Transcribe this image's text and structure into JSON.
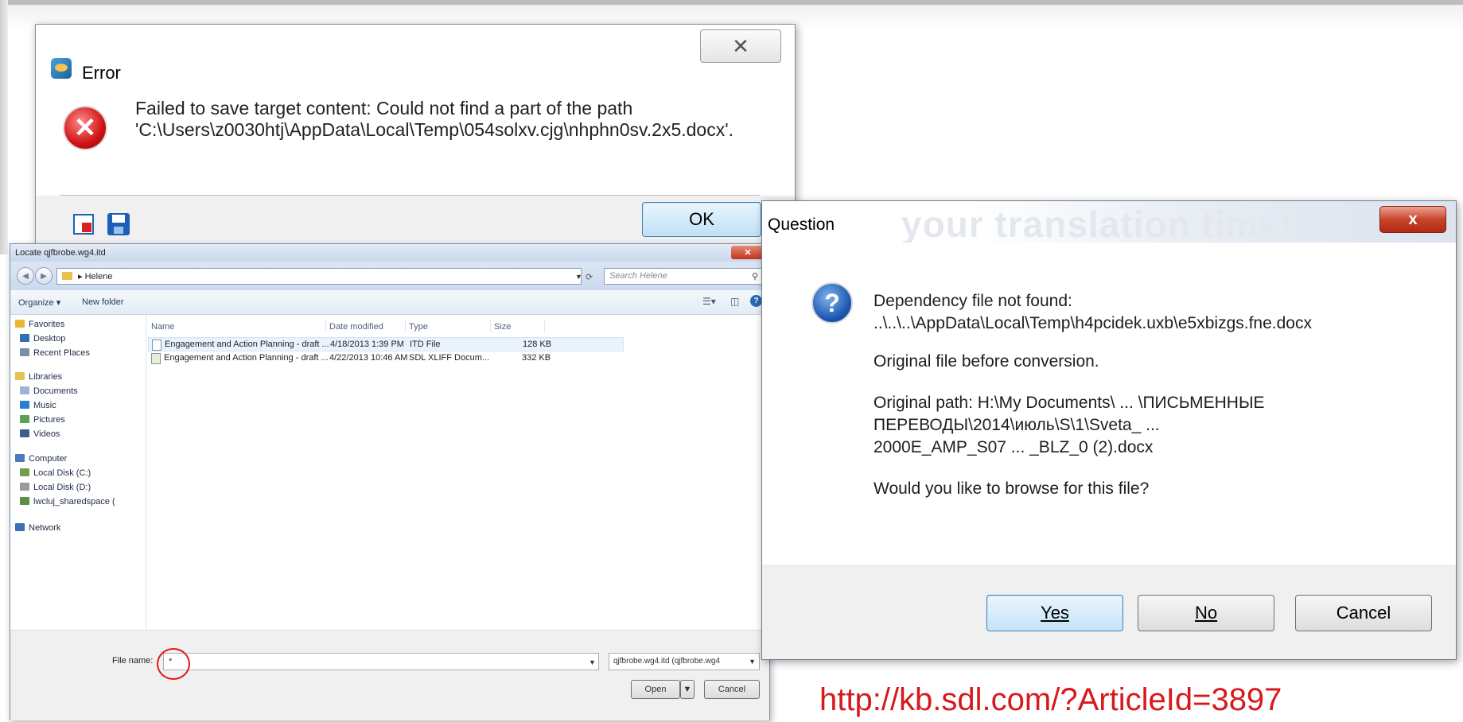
{
  "error_dialog": {
    "title": "Error",
    "message_line1": "Failed to save target content: Could not find a part of the path",
    "message_line2": "'C:\\Users\\z0030htj\\AppData\\Local\\Temp\\054solxv.cjg\\nhphn0sv.2x5.docx'.",
    "close_glyph": "✕",
    "ok_label": "OK"
  },
  "file_dialog": {
    "title": "Locate qjfbrobe.wg4.itd",
    "address": "▸ Helene",
    "search_placeholder": "Search Helene",
    "toolbar": {
      "organize": "Organize ▾",
      "new_folder": "New folder"
    },
    "sidebar": [
      {
        "label": "Favorites",
        "icon": "star-icon",
        "color": "#e9b534"
      },
      {
        "label": "Desktop",
        "icon": "desktop-icon",
        "color": "#2f6fb8"
      },
      {
        "label": "Recent Places",
        "icon": "recent-places-icon",
        "color": "#7a8fa8"
      },
      {
        "label": "Libraries",
        "icon": "libraries-icon",
        "color": "#e4c24f"
      },
      {
        "label": "Documents",
        "icon": "documents-icon",
        "color": "#9bb5d6"
      },
      {
        "label": "Music",
        "icon": "music-icon",
        "color": "#2a7fd0"
      },
      {
        "label": "Pictures",
        "icon": "pictures-icon",
        "color": "#5aa05a"
      },
      {
        "label": "Videos",
        "icon": "videos-icon",
        "color": "#3a5f8c"
      },
      {
        "label": "Computer",
        "icon": "computer-icon",
        "color": "#4a7bbf"
      },
      {
        "label": "Local Disk (C:)",
        "icon": "disk-icon",
        "color": "#6f9f4a"
      },
      {
        "label": "Local Disk (D:)",
        "icon": "disk-icon",
        "color": "#9a9a9a"
      },
      {
        "label": "lwcluj_sharedspace (",
        "icon": "network-drive-icon",
        "color": "#5b8f4a"
      },
      {
        "label": "Network",
        "icon": "network-icon",
        "color": "#3d6fb3"
      }
    ],
    "columns": {
      "name": "Name",
      "date": "Date modified",
      "type": "Type",
      "size": "Size"
    },
    "files": [
      {
        "name": "Engagement and Action Planning - draft ...",
        "date": "4/18/2013 1:39 PM",
        "type": "ITD File",
        "size": "128 KB"
      },
      {
        "name": "Engagement and Action Planning - draft ...",
        "date": "4/22/2013 10:46 AM",
        "type": "SDL XLIFF Docum...",
        "size": "332 KB"
      }
    ],
    "file_name_label": "File name:",
    "file_name_value": "*",
    "file_type": "qjfbrobe.wg4.itd (qjfbrobe.wg4",
    "open_label": "Open",
    "cancel_label": "Cancel"
  },
  "question_dialog": {
    "title": "Question",
    "watermark": "your translation time!",
    "close_glyph": "x",
    "line1": "Dependency file not found:",
    "line2": "..\\..\\..\\AppData\\Local\\Temp\\h4pcidek.uxb\\e5xbizgs.fne.docx",
    "line3": "Original file before conversion.",
    "line4": "Original path: H:\\My Documents\\ ... \\ПИСЬМЕННЫЕ",
    "line5": "ПЕРЕВОДЫ\\2014\\июль\\S\\1\\Sveta_ ... ",
    "line6": "2000E_AMP_S07 ... _BLZ_0 (2).docx",
    "line7": "Would you like to browse for this file?",
    "yes_label": "Yes",
    "no_label": "No",
    "cancel_label": "Cancel"
  },
  "footer_url": "http://kb.sdl.com/?ArticleId=3897"
}
